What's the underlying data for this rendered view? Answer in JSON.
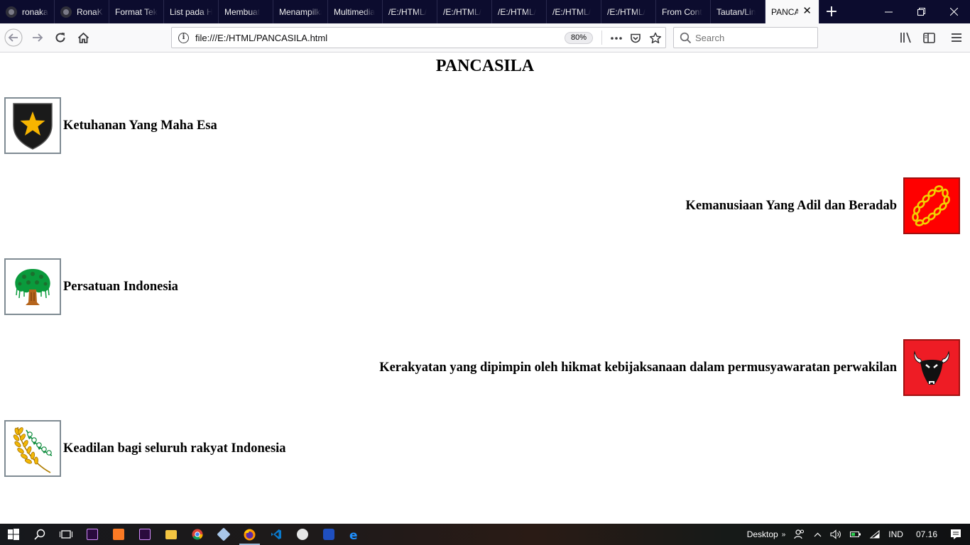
{
  "browser": {
    "tabs": [
      {
        "label": "ronaka",
        "icon": "github-icon"
      },
      {
        "label": "RonaK",
        "icon": "github-icon"
      },
      {
        "label": "Format Teks"
      },
      {
        "label": "List pada HTML"
      },
      {
        "label": "Membuat"
      },
      {
        "label": "Menampilkan"
      },
      {
        "label": "Multimedia"
      },
      {
        "label": "/E:/HTML/"
      },
      {
        "label": "/E:/HTML/"
      },
      {
        "label": "/E:/HTML/"
      },
      {
        "label": "/E:/HTML/"
      },
      {
        "label": "/E:/HTML/"
      },
      {
        "label": "From Cont"
      },
      {
        "label": "Tautan/Lin"
      }
    ],
    "active_tab": {
      "label": "PANCASILA"
    },
    "url": "file:///E:/HTML/PANCASILA.html",
    "zoom": "80%",
    "search_placeholder": "Search"
  },
  "page": {
    "title": "PANCASILA",
    "sila": [
      {
        "text": "Ketuhanan Yang Maha Esa",
        "icon": "star-shield-icon",
        "align": "left"
      },
      {
        "text": "Kemanusiaan Yang Adil dan Beradab",
        "icon": "chain-icon",
        "align": "right"
      },
      {
        "text": "Persatuan Indonesia",
        "icon": "banyan-tree-icon",
        "align": "left"
      },
      {
        "text": "Kerakyatan yang dipimpin oleh hikmat kebijaksanaan dalam permusyawaratan perwakilan",
        "icon": "bull-head-icon",
        "align": "right"
      },
      {
        "text": "Keadilan bagi seluruh rakyat Indonesia",
        "icon": "rice-cotton-icon",
        "align": "left"
      }
    ]
  },
  "taskbar": {
    "desktop_label": "Desktop",
    "language": "IND",
    "time": "07.16"
  },
  "colors": {
    "tabstrip_bg": "#0c0c2e",
    "chain_bg": "#ff0000",
    "bull_bg": "#ee1c25",
    "shield_black": "#1a1a1a",
    "star_gold": "#f7b500",
    "tree_green": "#0a9a3c"
  }
}
